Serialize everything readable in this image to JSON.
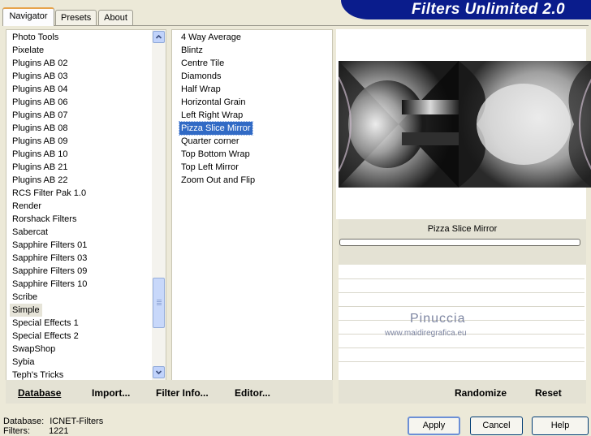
{
  "tabs": [
    {
      "label": "Navigator"
    },
    {
      "label": "Presets"
    },
    {
      "label": "About"
    }
  ],
  "banner": {
    "title": "Filters Unlimited 2.0"
  },
  "categories": [
    "Photo Tools",
    "Pixelate",
    "Plugins AB 02",
    "Plugins AB 03",
    "Plugins AB 04",
    "Plugins AB 06",
    "Plugins AB 07",
    "Plugins AB 08",
    "Plugins AB 09",
    "Plugins AB 10",
    "Plugins AB 21",
    "Plugins AB 22",
    "RCS Filter Pak 1.0",
    "Render",
    "Rorshack Filters",
    "Sabercat",
    "Sapphire Filters 01",
    "Sapphire Filters 03",
    "Sapphire Filters 09",
    "Sapphire Filters 10",
    "Scribe",
    "Simple",
    "Special Effects 1",
    "Special Effects 2",
    "SwapShop",
    "Sybia",
    "Teph's Tricks"
  ],
  "selected_category": "Simple",
  "filters": [
    "4 Way Average",
    "Blintz",
    "Centre Tile",
    "Diamonds",
    "Half Wrap",
    "Horizontal Grain",
    "Left Right Wrap",
    "Pizza Slice Mirror",
    "Quarter corner",
    "Top Bottom Wrap",
    "Top Left Mirror",
    "Zoom Out and Flip"
  ],
  "selected_filter": "Pizza Slice Mirror",
  "preview": {
    "filter_name": "Pizza Slice Mirror"
  },
  "left_buttons": {
    "database": "Database",
    "import": "Import...",
    "filter_info": "Filter Info...",
    "editor": "Editor..."
  },
  "right_buttons": {
    "randomize": "Randomize",
    "reset": "Reset"
  },
  "watermark": {
    "name": "Pinuccia",
    "url": "www.maidiregrafica.eu"
  },
  "status": {
    "database_label": "Database:",
    "database_value": "ICNET-Filters",
    "filters_label": "Filters:",
    "filters_value": "1221"
  },
  "dialog_buttons": {
    "apply": "Apply",
    "cancel": "Cancel",
    "help": "Help"
  }
}
